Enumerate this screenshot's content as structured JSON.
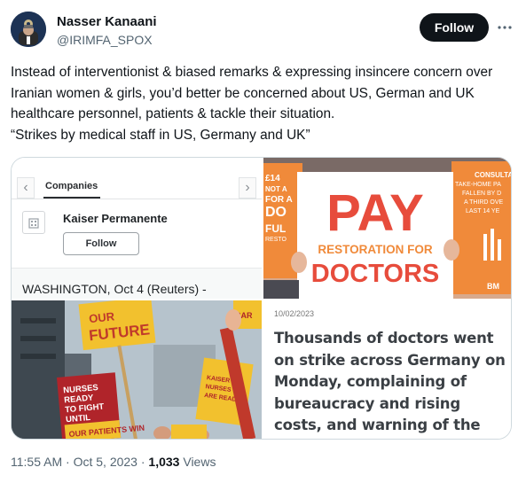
{
  "author": {
    "name": "Nasser Kanaani",
    "handle": "@IRIMFA_SPOX",
    "follow_label": "Follow",
    "more_icon": "more-horizontal-icon"
  },
  "tweet": {
    "text_paragraph_1": "Instead of interventionist & biased remarks & expressing insincere concern over Iranian women & girls, you’d better be concerned about US, German and UK healthcare personnel, patients & tackle their situation.",
    "text_paragraph_2": "“Strikes by medical staff in US, Germany and UK”"
  },
  "media": {
    "tile1": {
      "tab_label": "Companies",
      "company_name": "Kaiser Permanente",
      "follow_label": "Follow",
      "dateline": "WASHINGTON, Oct 4 (Reuters) -"
    },
    "tile2": {
      "sign_line1": "PAY",
      "sign_line2": "RESTORATION FOR",
      "sign_line3": "DOCTORS",
      "bg_sign_left": "£14 NOT A FOR A DO FUL RESTO",
      "bg_sign_right": "CONSULTA TAKE-HOME PA FALLEN BY D A THIRD OVE LAST 14 YE",
      "bg_logo": "BM"
    },
    "tile3": {
      "sign_top": "OUR FUTURE",
      "sign_red": "NURSES READY TO FIGHT UNTIL",
      "sign_bottom": "OUR PATIENTS WIN",
      "sign_right": "KAISER NURSES ARE READY TO STRIKE",
      "sign_far_right": "CAR"
    },
    "tile4": {
      "date": "10/02/2023",
      "headline": "Thousands of doctors went on strike across Germany on Monday, complaining of bureaucracy and rising costs, and warning of the threat"
    }
  },
  "meta": {
    "time": "11:55 AM",
    "separator": "·",
    "date": "Oct 5, 2023",
    "views_count": "1,033",
    "views_label": "Views"
  },
  "colors": {
    "follow_bg": "#0f1419",
    "pay_sign_red": "#e74c3c",
    "orange_sign": "#f08a3a"
  }
}
